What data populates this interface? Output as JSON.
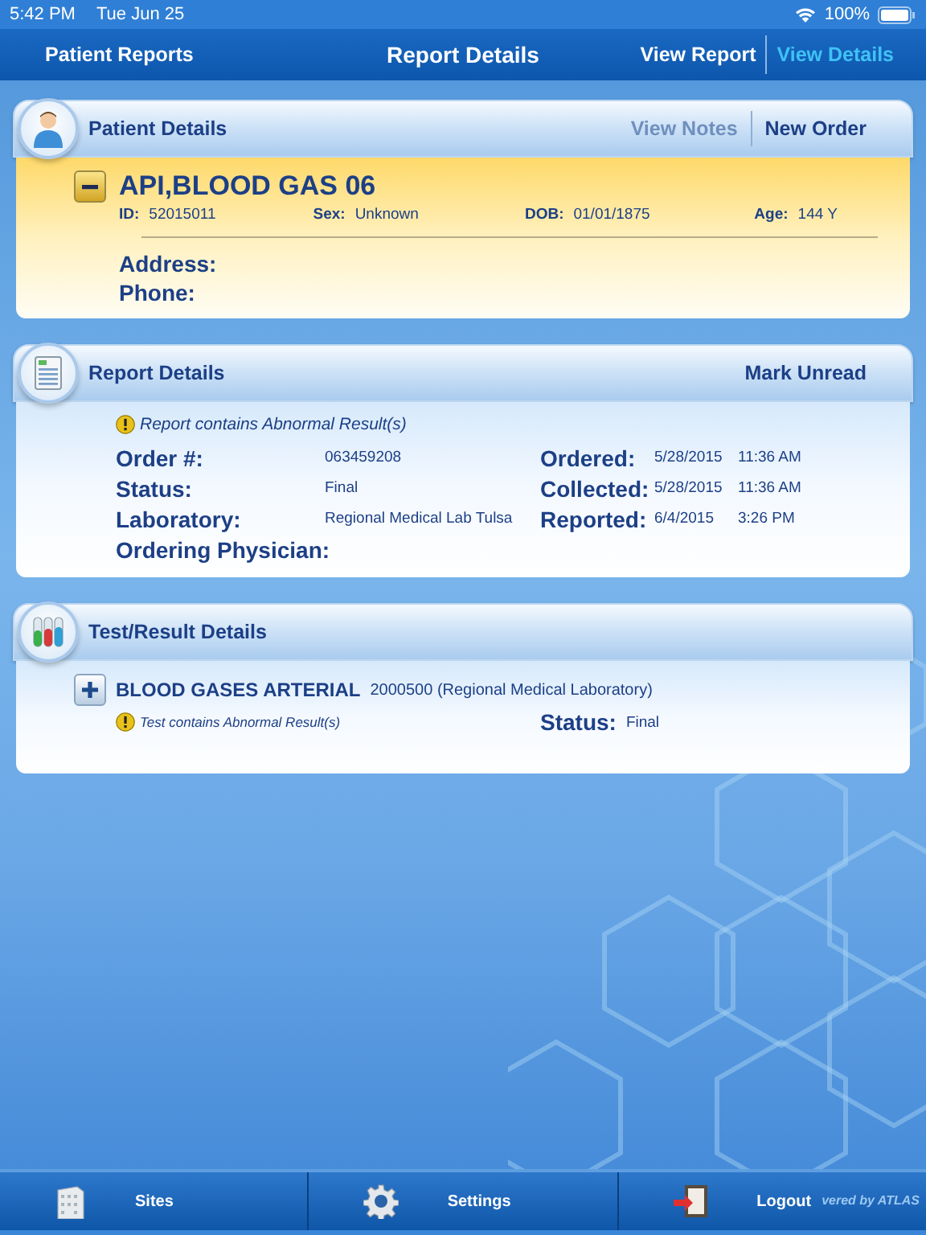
{
  "status_bar": {
    "time": "5:42 PM",
    "date": "Tue Jun 25",
    "battery": "100%"
  },
  "nav": {
    "back": "Patient Reports",
    "title": "Report Details",
    "segments": [
      {
        "label": "View Report",
        "selected": false
      },
      {
        "label": "View Details",
        "selected": true
      }
    ]
  },
  "patient": {
    "title": "Patient Details",
    "actions": [
      {
        "label": "View Notes",
        "disabled": true
      },
      {
        "label": "New Order",
        "disabled": false
      }
    ],
    "expanded": true,
    "name": "API,BLOOD GAS 06",
    "fields": [
      {
        "label": "ID:",
        "value": "52015011"
      },
      {
        "label": "Sex:",
        "value": "Unknown"
      },
      {
        "label": "DOB:",
        "value": "01/01/1875"
      },
      {
        "label": "Age:",
        "value": "144 Y"
      }
    ],
    "contact": [
      "Address:",
      "Phone:"
    ]
  },
  "report": {
    "title": "Report Details",
    "action": "Mark Unread",
    "alert": "Report contains Abnormal Result(s)",
    "left": [
      {
        "label": "Order #:",
        "value": "063459208"
      },
      {
        "label": "Status:",
        "value": "Final"
      },
      {
        "label": "Laboratory:",
        "value": "Regional Medical Lab Tulsa"
      },
      {
        "label": "Ordering Physician:"
      }
    ],
    "right": [
      {
        "label": "Ordered:",
        "date": "5/28/2015",
        "time": "11:36 AM"
      },
      {
        "label": "Collected:",
        "date": "5/28/2015",
        "time": "11:36 AM"
      },
      {
        "label": "Reported:",
        "date": "6/4/2015",
        "time": "3:26 PM"
      }
    ]
  },
  "tests": {
    "title": "Test/Result Details",
    "items": [
      {
        "name": "BLOOD GASES ARTERIAL",
        "code": "2000500 (Regional Medical Laboratory)",
        "expanded": false,
        "alert": "Test contains Abnormal Result(s)",
        "status_label": "Status:",
        "status": "Final"
      }
    ]
  },
  "tab_bar": [
    {
      "label": "Sites",
      "kind": "building"
    },
    {
      "label": "Settings",
      "kind": "gear"
    },
    {
      "label": "Logout",
      "kind": "door"
    }
  ],
  "brand": "vered by ATLAS"
}
